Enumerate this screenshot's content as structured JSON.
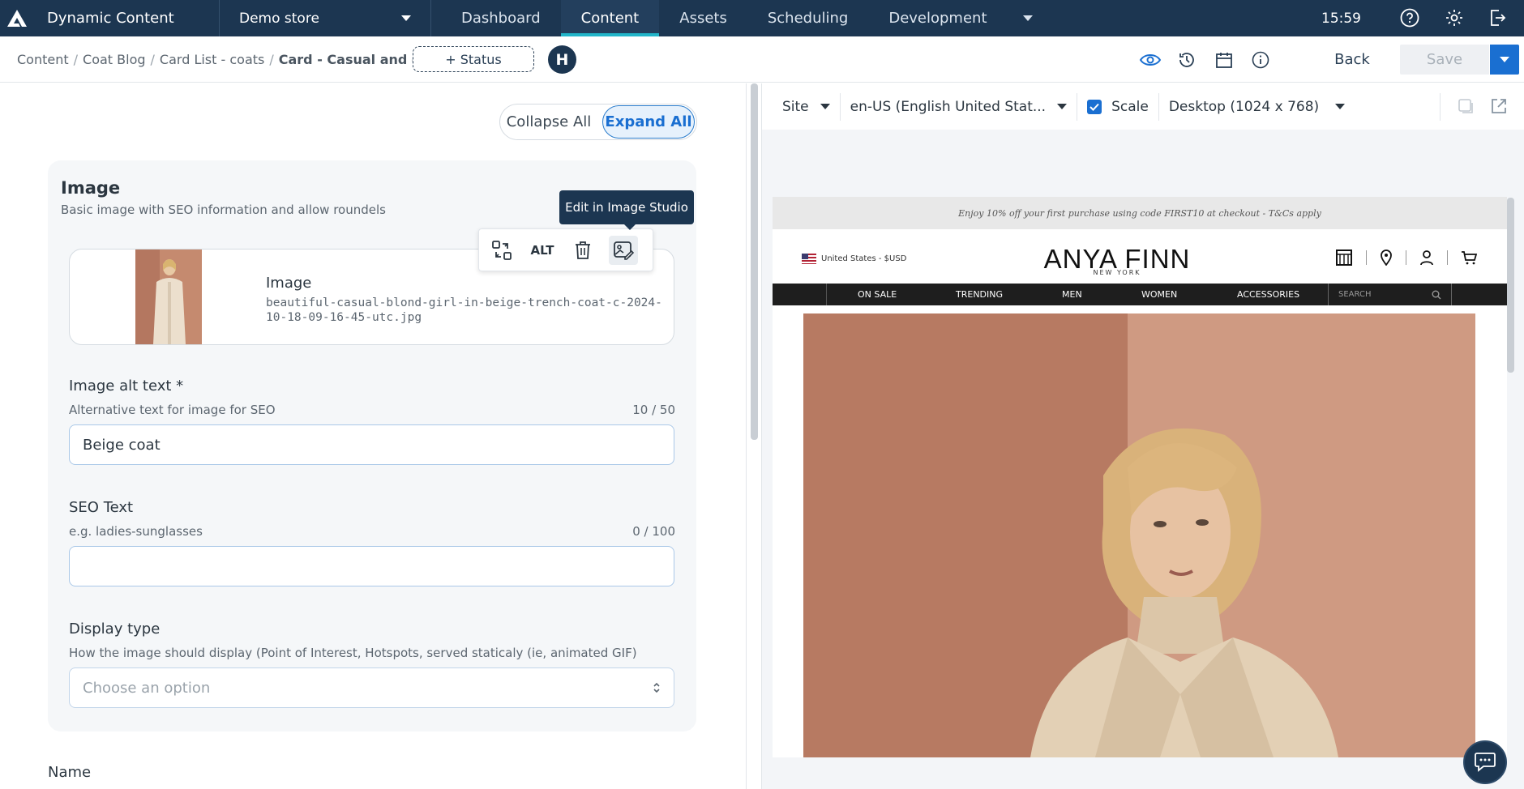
{
  "app": {
    "title": "Dynamic Content",
    "store": "Demo store",
    "nav_tabs": [
      {
        "label": "Dashboard"
      },
      {
        "label": "Content"
      },
      {
        "label": "Assets"
      },
      {
        "label": "Scheduling"
      },
      {
        "label": "Development"
      }
    ],
    "time": "15:59",
    "icons": [
      "help-icon",
      "settings-icon",
      "logout-icon"
    ]
  },
  "subbar": {
    "breadcrumbs": [
      "Content",
      "Coat Blog",
      "Card List - coats",
      "Card - Casual and chic"
    ],
    "status_button": "+ Status",
    "avatar_initial": "H",
    "icons": [
      "eye-icon",
      "history-icon",
      "calendar-icon",
      "info-icon"
    ],
    "back_label": "Back",
    "save_label": "Save",
    "accent": "#1a6fd1"
  },
  "editor": {
    "collapse_all": "Collapse All",
    "expand_all": "Expand All",
    "card": {
      "title": "Image",
      "subtitle": "Basic image with SEO information and allow roundels",
      "tooltip": "Edit in Image Studio",
      "toolbar": {
        "alt_label": "ALT",
        "icons": [
          "swap-icon",
          "alt-text-icon",
          "trash-icon",
          "image-edit-icon"
        ]
      },
      "image": {
        "label": "Image",
        "filename": "beautiful-casual-blond-girl-in-beige-trench-coat-c-2024-10-18-09-16-45-utc.jpg"
      },
      "fields": {
        "alt_text": {
          "label": "Image alt text *",
          "help": "Alternative text for image for SEO",
          "count": "10 / 50",
          "value": "Beige coat"
        },
        "seo_text": {
          "label": "SEO Text",
          "help": "e.g. ladies-sunglasses",
          "count": "0 / 100",
          "value": ""
        },
        "display_type": {
          "label": "Display type",
          "help": "How the image should display (Point of Interest, Hotspots, served staticaly (ie, animated GIF)",
          "placeholder": "Choose an option"
        }
      }
    },
    "name_label": "Name"
  },
  "preview": {
    "site_label": "Site",
    "locale": "en-US (English United Stat...",
    "scale_label": "Scale",
    "scale_checked": true,
    "device": "Desktop (1024 x 768)",
    "website": {
      "promo": "Enjoy 10% off your first purchase using code FIRST10 at checkout - T&Cs apply",
      "locale": "United States - $USD",
      "brand": "ANYA FINN",
      "brand_sub": "NEW YORK",
      "nav": [
        "ON SALE",
        "TRENDING",
        "MEN",
        "WOMEN",
        "ACCESSORIES"
      ],
      "search_placeholder": "SEARCH"
    }
  }
}
